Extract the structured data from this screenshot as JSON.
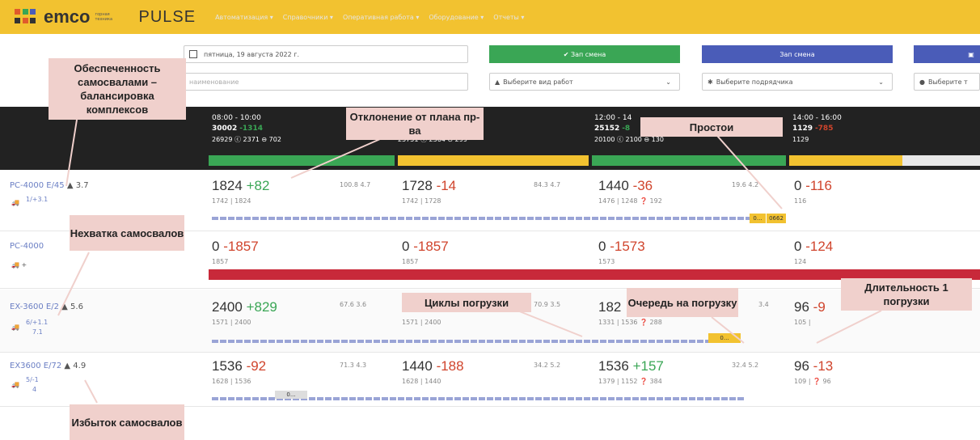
{
  "header": {
    "logo": "emco",
    "logo_sub": "горная техника",
    "app": "PULSE",
    "menu": [
      "Автоматизация ▾",
      "Справочники ▾",
      "Оперативная работа ▾",
      "Оборудование ▾",
      "Отчеты ▾"
    ]
  },
  "controls": {
    "date": "пятница, 19 августа 2022 г.",
    "name_placeholder": "наименование",
    "work_type": "Выберите вид работ",
    "contractor": "Выберите подрядчика",
    "type_select": "Выберите т",
    "btn_green": "✔ Зап смена",
    "btn_blue": "Зап смена"
  },
  "slots": [
    {
      "time": "08:00 - 10:00",
      "plan": "30002",
      "dev": "-1314",
      "meta": "26929 ⓒ 2371 ⊖ 702"
    },
    {
      "time": "",
      "plan": "",
      "dev": "",
      "meta": "25751 ⓒ 2364 ⊖ 299"
    },
    {
      "time": "12:00 - 14",
      "plan": "25152",
      "dev": "-8",
      "meta": "20100 ⓒ 2100 ⊖ 130"
    },
    {
      "time": "14:00 - 16:00",
      "plan": "1129",
      "dev": "-785",
      "meta": "1129"
    }
  ],
  "rows": [
    {
      "name": "PC-4000 E/45",
      "rating": "3.7",
      "trucks": "1/+3.1",
      "trucks_den": "4",
      "cells": [
        {
          "value": "1824",
          "dev": "+82",
          "sub": "1742 | 1824",
          "stats": "100.8  4.7"
        },
        {
          "value": "1728",
          "dev": "-14",
          "sub": "1742 | 1728",
          "stats": "84.3  4.7"
        },
        {
          "value": "1440",
          "dev": "-36",
          "sub": "1476 | 1248 ❓ 192",
          "stats": "19.6  4.2"
        },
        {
          "value": "0",
          "dev": "-116",
          "sub": "116",
          "stats": ""
        }
      ]
    },
    {
      "name": "PC-4000",
      "rating": "",
      "trucks": "",
      "trucks_den": "",
      "cells": [
        {
          "value": "0",
          "dev": "-1857",
          "sub": "1857",
          "stats": ""
        },
        {
          "value": "0",
          "dev": "-1857",
          "sub": "1857",
          "stats": ""
        },
        {
          "value": "0",
          "dev": "-1573",
          "sub": "1573",
          "stats": ""
        },
        {
          "value": "0",
          "dev": "-124",
          "sub": "124",
          "stats": ""
        }
      ]
    },
    {
      "name": "EX-3600 E/2",
      "rating": "5.6",
      "trucks": "6/+1.1",
      "trucks_den": "7.1",
      "cells": [
        {
          "value": "2400",
          "dev": "+829",
          "sub": "1571 | 2400",
          "stats": "67.6  3.6"
        },
        {
          "value": "",
          "dev": "",
          "sub": "1571 | 2400",
          "stats": "70.9  3.5"
        },
        {
          "value": "182",
          "dev": "",
          "sub": "1331 | 1536 ❓ 288",
          "stats": "3.4"
        },
        {
          "value": "96",
          "dev": "-9",
          "sub": "105 |",
          "stats": ""
        }
      ]
    },
    {
      "name": "EX3600 E/72",
      "rating": "4.9",
      "trucks": "5/-1",
      "trucks_den": "4",
      "cells": [
        {
          "value": "1536",
          "dev": "-92",
          "sub": "1628 | 1536",
          "stats": "71.3  4.3"
        },
        {
          "value": "1440",
          "dev": "-188",
          "sub": "1628 | 1440",
          "stats": "34.2  5.2"
        },
        {
          "value": "1536",
          "dev": "+157",
          "sub": "1379 | 1152 ❓ 384",
          "stats": "32.4  5.2"
        },
        {
          "value": "96",
          "dev": "-13",
          "sub": "109 | ❓ 96",
          "stats": ""
        }
      ]
    }
  ],
  "annotations": {
    "a1": "Обеспеченность самосвалами – балансировка комплексов",
    "a2": "Отклонение от плана пр-ва",
    "a3": "Простои",
    "a4": "Нехватка самосвалов",
    "a5": "Циклы погрузки",
    "a6": "Очередь на погрузку",
    "a7": "Длительность 1 погрузки",
    "a8": "Избыток самосвалов"
  },
  "markers": {
    "m1": "0...",
    "m2": "0662",
    "m3": "0...",
    "m4": "0..."
  },
  "colors": {
    "accent": "#f2c230",
    "green": "#3aa655",
    "red": "#c8293a",
    "blue": "#4a5cb8"
  }
}
